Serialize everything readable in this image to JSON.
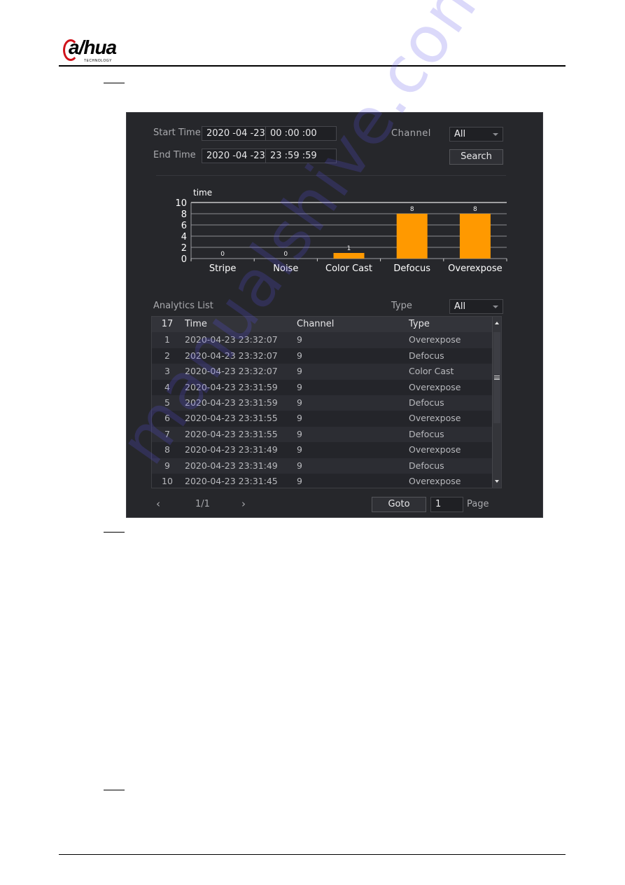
{
  "document": {
    "logo_text": "a/hua",
    "logo_subtext": "TECHNOLOGY",
    "watermark": "manualshive.com"
  },
  "search": {
    "start_time_label": "Start Time",
    "start_date": "2020 -04 -23",
    "start_clock": "00 :00 :00",
    "end_time_label": "End Time",
    "end_date": "2020 -04 -23",
    "end_clock": "23 :59 :59",
    "channel_label": "Channel",
    "channel_value": "All",
    "search_button": "Search"
  },
  "colors": {
    "bar": "#ff9900",
    "panel_bg": "#26272b",
    "gridline": "#8c8d92"
  },
  "chart_data": {
    "type": "bar",
    "title": "",
    "ylabel": "time",
    "xlabel": "",
    "categories": [
      "Stripe",
      "Noise",
      "Color Cast",
      "Defocus",
      "Overexpose"
    ],
    "values": [
      0,
      0,
      1,
      8,
      8
    ],
    "ylim": [
      0,
      10
    ],
    "yticks": [
      0,
      2,
      4,
      6,
      8,
      10
    ],
    "grid": true,
    "data_labels": true
  },
  "analytics": {
    "list_label": "Analytics List",
    "type_label": "Type",
    "type_value": "All",
    "columns": [
      "17",
      "Time",
      "Channel",
      "Type"
    ],
    "rows": [
      {
        "no": "1",
        "time": "2020-04-23 23:32:07",
        "channel": "9",
        "type": "Overexpose"
      },
      {
        "no": "2",
        "time": "2020-04-23 23:32:07",
        "channel": "9",
        "type": "Defocus"
      },
      {
        "no": "3",
        "time": "2020-04-23 23:32:07",
        "channel": "9",
        "type": "Color Cast"
      },
      {
        "no": "4",
        "time": "2020-04-23 23:31:59",
        "channel": "9",
        "type": "Overexpose"
      },
      {
        "no": "5",
        "time": "2020-04-23 23:31:59",
        "channel": "9",
        "type": "Defocus"
      },
      {
        "no": "6",
        "time": "2020-04-23 23:31:55",
        "channel": "9",
        "type": "Overexpose"
      },
      {
        "no": "7",
        "time": "2020-04-23 23:31:55",
        "channel": "9",
        "type": "Defocus"
      },
      {
        "no": "8",
        "time": "2020-04-23 23:31:49",
        "channel": "9",
        "type": "Overexpose"
      },
      {
        "no": "9",
        "time": "2020-04-23 23:31:49",
        "channel": "9",
        "type": "Defocus"
      },
      {
        "no": "10",
        "time": "2020-04-23 23:31:45",
        "channel": "9",
        "type": "Overexpose"
      }
    ]
  },
  "pager": {
    "prev_icon": "‹",
    "page_indicator": "1/1",
    "next_icon": "›",
    "goto_button": "Goto",
    "page_input": "1",
    "page_label": "Page"
  }
}
